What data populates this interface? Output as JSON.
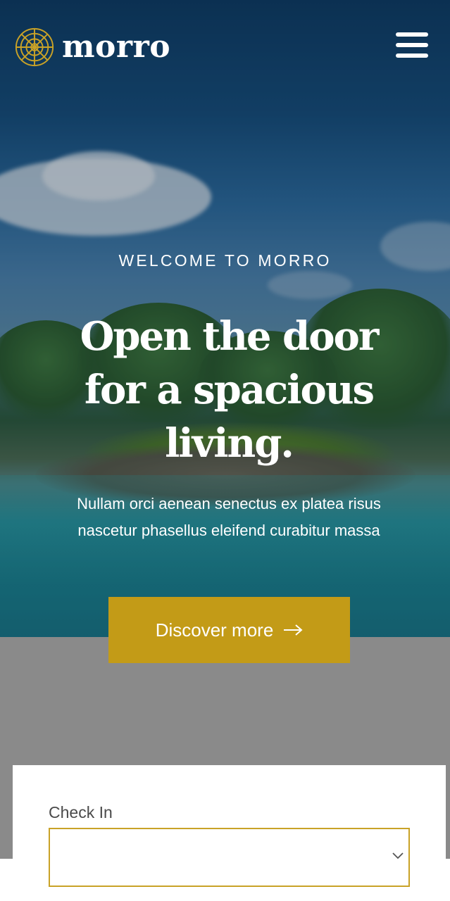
{
  "header": {
    "logo_text": "morro",
    "logo_icon": "mandala-logo-icon",
    "menu_icon": "hamburger-menu-icon"
  },
  "hero": {
    "eyebrow": "WELCOME TO MORRO",
    "headline": "Open the door for a spacious living.",
    "subtext": "Nullam orci aenean senectus ex platea risus nascetur phasellus eleifend curabitur massa",
    "cta_label": "Discover more",
    "cta_icon": "arrow-right-icon"
  },
  "booking": {
    "check_in_label": "Check In",
    "check_in_value": "",
    "dropdown_icon": "chevron-down-icon"
  },
  "colors": {
    "accent": "#c39b17",
    "input_border": "#c9a227",
    "backdrop_gray": "#8a8a8a",
    "sky": "#154d7c",
    "water": "#1a7886"
  }
}
